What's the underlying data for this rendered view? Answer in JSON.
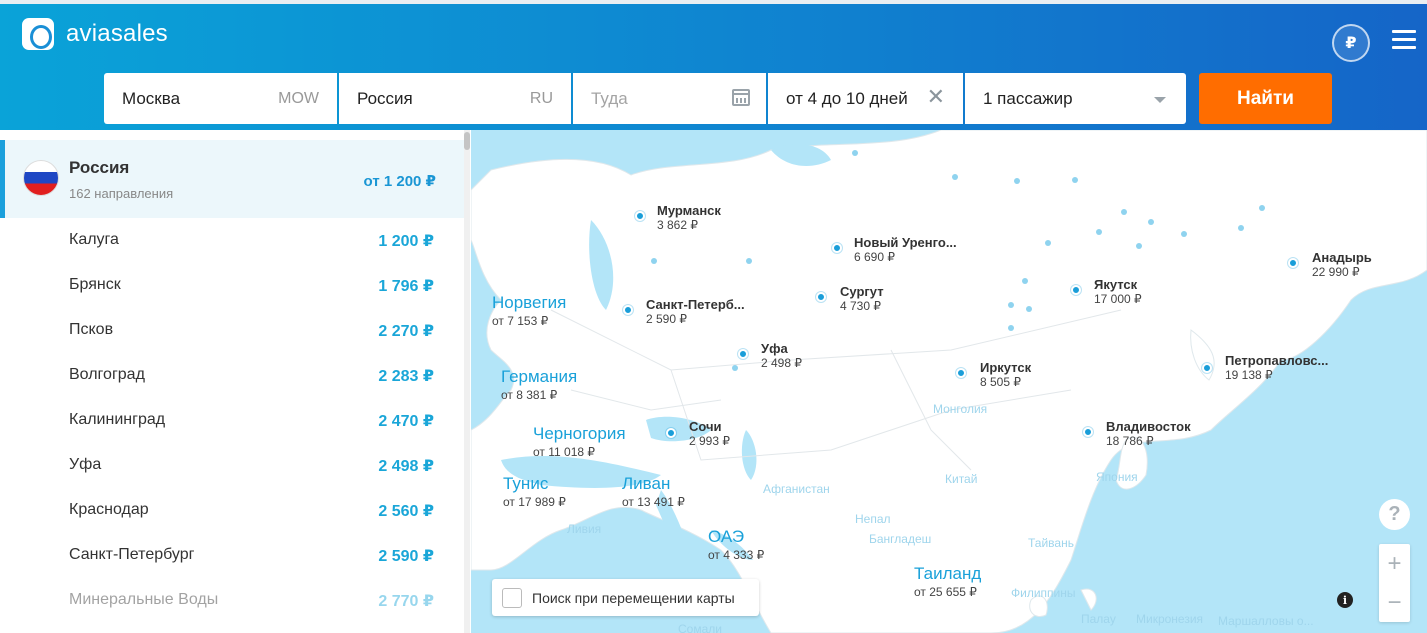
{
  "header": {
    "logo_text": "aviasales",
    "currency_symbol": "₽",
    "search": {
      "origin": "Москва",
      "origin_code": "MOW",
      "destination": "Россия",
      "destination_code": "RU",
      "date_placeholder": "Туда",
      "duration": "от 4 до 10 дней",
      "passengers": "1 пассажир",
      "find_label": "Найти"
    }
  },
  "sidebar": {
    "country": {
      "name": "Россия",
      "subtitle": "162 направления",
      "price": "от 1 200 ₽"
    },
    "cities": [
      {
        "name": "Калуга",
        "price": "1 200 ₽"
      },
      {
        "name": "Брянск",
        "price": "1 796 ₽"
      },
      {
        "name": "Псков",
        "price": "2 270 ₽"
      },
      {
        "name": "Волгоград",
        "price": "2 283 ₽"
      },
      {
        "name": "Калининград",
        "price": "2 470 ₽"
      },
      {
        "name": "Уфа",
        "price": "2 498 ₽"
      },
      {
        "name": "Краснодар",
        "price": "2 560 ₽"
      },
      {
        "name": "Санкт-Петербург",
        "price": "2 590 ₽"
      },
      {
        "name": "Минеральные Воды",
        "price": "2 770 ₽"
      }
    ]
  },
  "map": {
    "cities": [
      {
        "name": "Мурманск",
        "price": "3 862 ₽"
      },
      {
        "name": "Новый Уренго...",
        "price": "6 690 ₽"
      },
      {
        "name": "Сургут",
        "price": "4 730 ₽"
      },
      {
        "name": "Санкт-Петерб...",
        "price": "2 590 ₽"
      },
      {
        "name": "Уфа",
        "price": "2 498 ₽"
      },
      {
        "name": "Якутск",
        "price": "17 000 ₽"
      },
      {
        "name": "Анадырь",
        "price": "22 990 ₽"
      },
      {
        "name": "Иркутск",
        "price": "8 505 ₽"
      },
      {
        "name": "Петропавловс...",
        "price": "19 138 ₽"
      },
      {
        "name": "Владивосток",
        "price": "18 786 ₽"
      },
      {
        "name": "Сочи",
        "price": "2 993 ₽"
      }
    ],
    "countries": [
      {
        "name": "Норвегия",
        "price": "от 7 153 ₽"
      },
      {
        "name": "Германия",
        "price": "от 8 381 ₽"
      },
      {
        "name": "Черногория",
        "price": "от 11 018 ₽"
      },
      {
        "name": "Тунис",
        "price": "от 17 989 ₽"
      },
      {
        "name": "Ливан",
        "price": "от 13 491 ₽"
      },
      {
        "name": "ОАЭ",
        "price": "от 4 333 ₽"
      },
      {
        "name": "Таиланд",
        "price": "от 25 655 ₽"
      }
    ],
    "faded_labels": [
      "Монголия",
      "Афганистан",
      "Китай",
      "Япония",
      "Непал",
      "Бангладеш",
      "Тайвань",
      "Ливия",
      "Сомали",
      "Филиппины",
      "Палау",
      "Микронезия",
      "Маршалловы о..."
    ],
    "move_search_label": "Поиск при перемещении карты",
    "help_symbol": "?",
    "zoom_in": "+",
    "zoom_out": "−",
    "info_symbol": "i"
  },
  "colors": {
    "accent": "#1a9ed9",
    "brand_orange": "#ff6d00",
    "sea": "#b3e5f8"
  }
}
